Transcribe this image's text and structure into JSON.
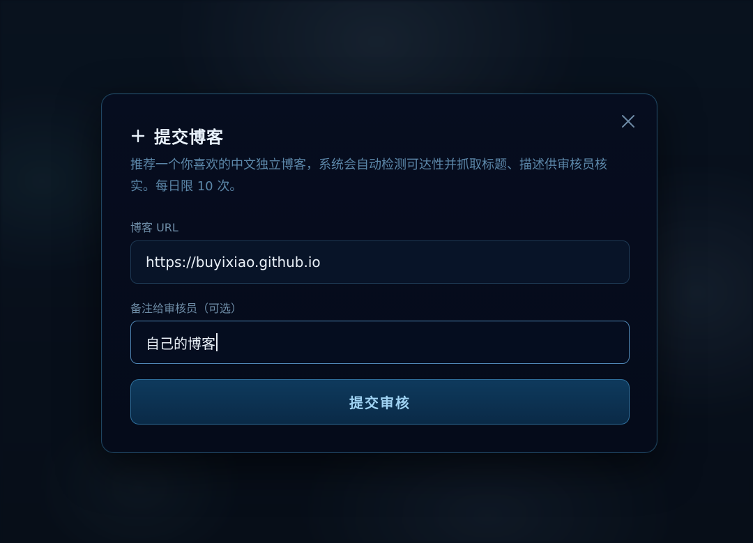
{
  "modal": {
    "title": "提交博客",
    "title_icon": "plus-icon",
    "close_icon": "close-icon",
    "description": "推荐一个你喜欢的中文独立博客，系统会自动检测可达性并抓取标题、描述供审核员核实。每日限 10 次。"
  },
  "form": {
    "url_label": "博客 URL",
    "url_value": "https://buyixiao.github.io",
    "note_label": "备注给审核员（可选）",
    "note_value": "自己的博客",
    "submit_label": "提交审核"
  },
  "colors": {
    "accent": "#4f86b5",
    "title": "#e9f2fb",
    "description": "#5c87a9",
    "button_text": "#9fd2f2"
  }
}
